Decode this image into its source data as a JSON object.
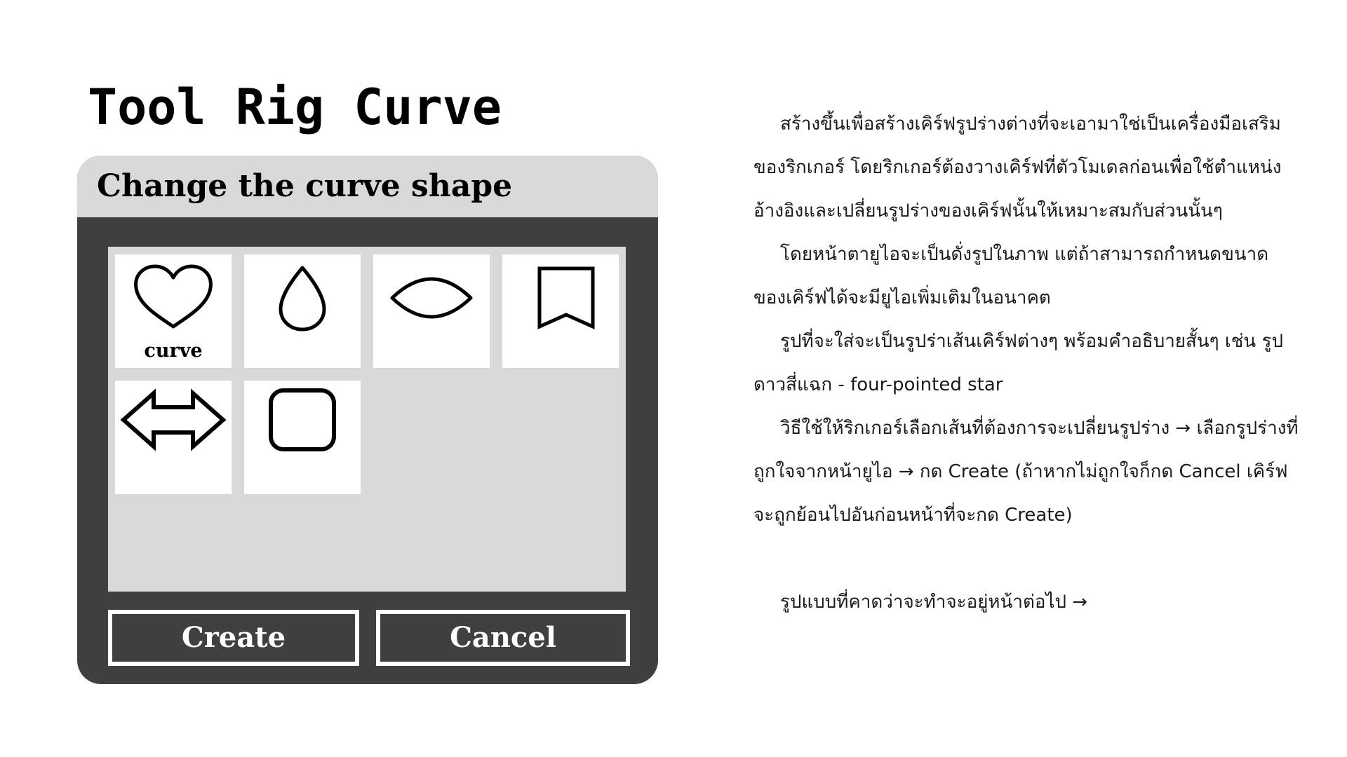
{
  "page": {
    "title": "Tool Rig Curve"
  },
  "window": {
    "title": "Change the curve shape",
    "shapes": [
      {
        "icon": "heart-icon",
        "label": "curve"
      },
      {
        "icon": "teardrop-icon",
        "label": ""
      },
      {
        "icon": "lens-icon",
        "label": ""
      },
      {
        "icon": "bookmark-icon",
        "label": ""
      },
      {
        "icon": "double-arrow-icon",
        "label": ""
      },
      {
        "icon": "rounded-square-icon",
        "label": ""
      }
    ],
    "create_label": "Create",
    "cancel_label": "Cancel"
  },
  "description": {
    "p1": "สร้างขึ้นเพื่อสร้างเคิร์ฟรูปร่างต่างที่จะเอามาใช่เป็นเครื่องมือเสริมของริกเกอร์ โดยริกเกอร์ต้องวางเคิร์ฟที่ตัวโมเดลก่อนเพื่อใช้ตำแหน่งอ้างอิงและเปลี่ยนรูปร่างของเคิร์ฟนั้นให้เหมาะสมกับส่วนนั้นๆ",
    "p2": "โดยหน้าตายูไอจะเป็นดั่งรูปในภาพ แต่ถ้าสามารถกำหนดขนาดของเคิร์ฟได้จะมียูไอเพิ่มเติมในอนาคต",
    "p3": "รูปที่จะใส่จะเป็นรูปร่าเส้นเคิร์ฟต่างๆ พร้อมคำอธิบายสั้นๆ เช่น  รูปดาวสี่แฉก - four-pointed star",
    "p4": "วิธีใช้ให้ริกเกอร์เลือกเส้นที่ต้องการจะเปลี่ยนรูปร่าง → เลือกรูปร่างที่ถูกใจจากหน้ายูไอ → กด Create (ถ้าหากไม่ถูกใจก็กด Cancel เคิร์ฟจะถูกย้อนไปอันก่อนหน้าที่จะกด Create)",
    "p5": "รูปแบบที่คาดว่าจะทำจะอยู่หน้าต่อไป →"
  },
  "colors": {
    "window_dark": "#404040",
    "panel_gray": "#d9d9d9",
    "tile_white": "#ffffff"
  }
}
